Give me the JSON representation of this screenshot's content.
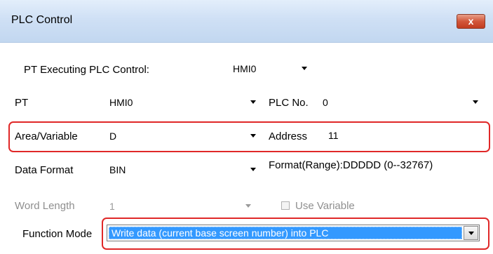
{
  "window": {
    "title": "PLC Control",
    "close_glyph": "x"
  },
  "pt_executing": {
    "label": "PT Executing PLC Control:",
    "value": "HMI0"
  },
  "pt": {
    "label": "PT",
    "value": "HMI0"
  },
  "plc_no": {
    "label": "PLC No.",
    "value": "0"
  },
  "area_variable": {
    "label": "Area/Variable",
    "value": "D"
  },
  "address": {
    "label": "Address",
    "value": "11"
  },
  "data_format": {
    "label": "Data  Format",
    "value": "BIN",
    "range_text": "Format(Range):DDDDD (0--32767)"
  },
  "word_length": {
    "label": "Word Length",
    "value": "1",
    "disabled": true
  },
  "use_variable": {
    "label": "Use Variable",
    "checked": false,
    "disabled": true
  },
  "function_mode": {
    "label": "Function Mode",
    "value": "Write data (current base screen number) into PLC"
  },
  "colors": {
    "highlight": "#e02828",
    "selection": "#3399ff",
    "titlebar": "#cfe0f5",
    "close": "#c94a2e"
  }
}
